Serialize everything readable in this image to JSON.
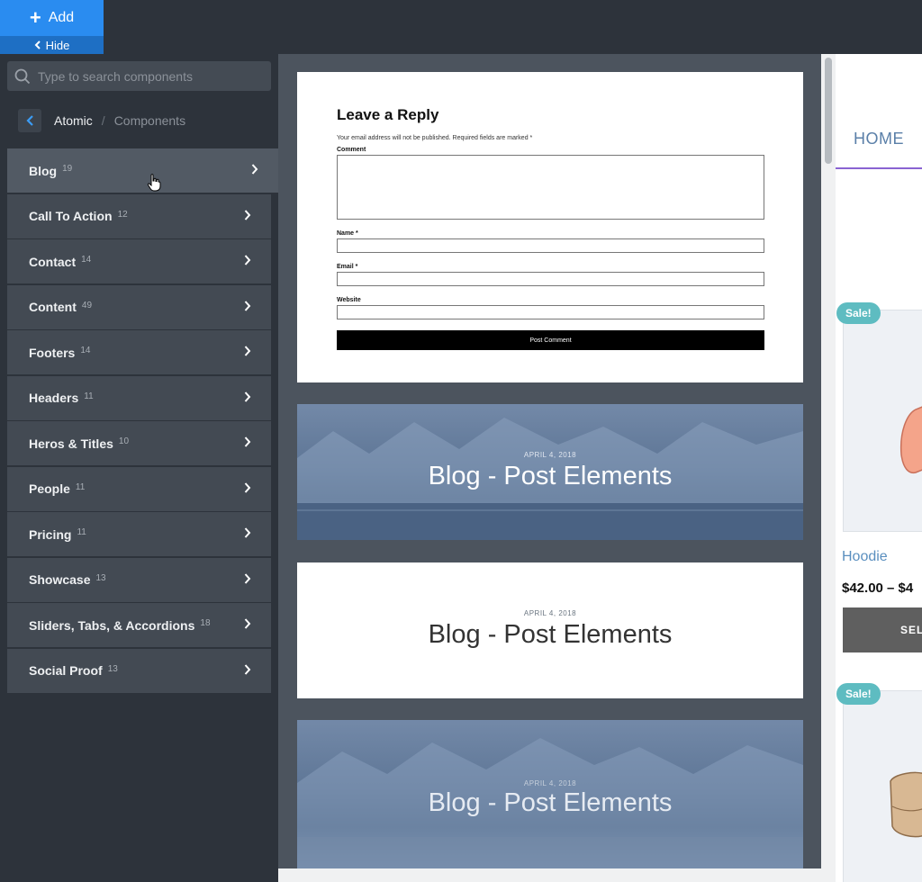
{
  "toolbar": {
    "add_label": "Add",
    "hide_label": "Hide"
  },
  "sidebar": {
    "search_placeholder": "Type to search components",
    "breadcrumb": {
      "current": "Atomic",
      "separator": "/",
      "child": "Components"
    },
    "categories": [
      {
        "label": "Blog",
        "count": "19"
      },
      {
        "label": "Call To Action",
        "count": "12"
      },
      {
        "label": "Contact",
        "count": "14"
      },
      {
        "label": "Content",
        "count": "49"
      },
      {
        "label": "Footers",
        "count": "14"
      },
      {
        "label": "Headers",
        "count": "11"
      },
      {
        "label": "Heros & Titles",
        "count": "10"
      },
      {
        "label": "People",
        "count": "11"
      },
      {
        "label": "Pricing",
        "count": "11"
      },
      {
        "label": "Showcase",
        "count": "13"
      },
      {
        "label": "Sliders, Tabs, & Accordions",
        "count": "18"
      },
      {
        "label": "Social Proof",
        "count": "13"
      }
    ]
  },
  "previews": {
    "reply": {
      "title": "Leave a Reply",
      "note": "Your email address will not be published. Required fields are marked *",
      "comment_label": "Comment",
      "name_label": "Name *",
      "email_label": "Email *",
      "website_label": "Website",
      "post_button": "Post Comment"
    },
    "post_elements": [
      {
        "date": "APRIL 4, 2018",
        "title": "Blog - Post Elements"
      },
      {
        "date": "APRIL 4, 2018",
        "title": "Blog - Post Elements"
      },
      {
        "date": "APRIL 4, 2018",
        "title": "Blog - Post Elements"
      }
    ]
  },
  "site_preview": {
    "nav_home": "HOME",
    "sale_badge": "Sale!",
    "product_name": "Hoodie",
    "product_price": "$42.00 – $4",
    "select_button": "SEL"
  },
  "colors": {
    "accent": "#2a8cf0",
    "panel": "#2d333b",
    "item": "#434a53",
    "sale": "#5ebcc1"
  }
}
